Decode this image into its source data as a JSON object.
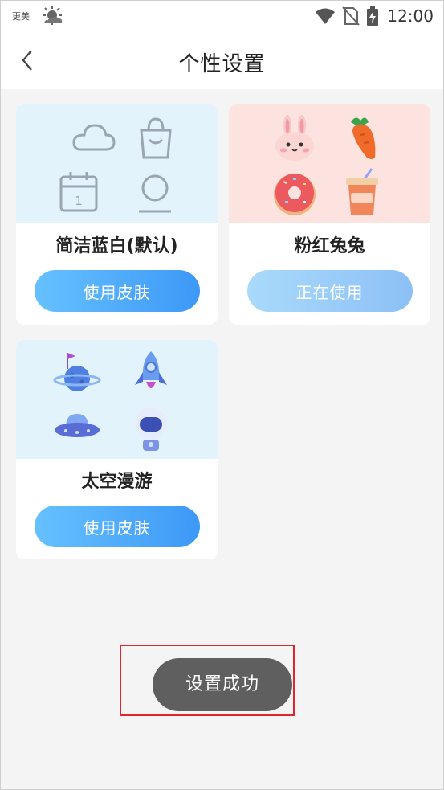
{
  "status_bar": {
    "carrier_label": "更美",
    "time": "12:00"
  },
  "header": {
    "title": "个性设置"
  },
  "skins": [
    {
      "name": "简洁蓝白(默认)",
      "button_label": "使用皮肤",
      "thumb_color": "#e3f3fb"
    },
    {
      "name": "粉红兔兔",
      "button_label": "正在使用",
      "thumb_color": "#fde3e0"
    },
    {
      "name": "太空漫游",
      "button_label": "使用皮肤",
      "thumb_color": "#e3f3fb"
    }
  ],
  "toast": {
    "message": "设置成功"
  }
}
